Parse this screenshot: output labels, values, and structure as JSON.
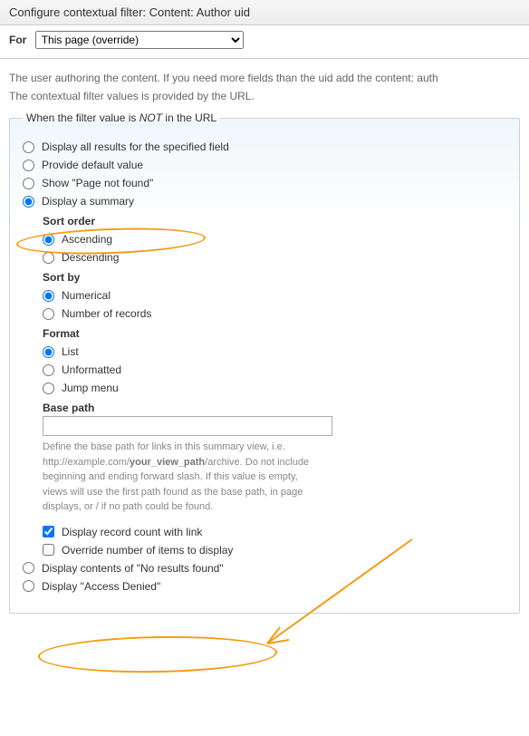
{
  "header": {
    "title": "Configure contextual filter: Content: Author uid",
    "for_label": "For",
    "for_value": "This page (override)"
  },
  "description": {
    "line1": "The user authoring the content. If you need more fields than the uid add the content: auth",
    "line2": "The contextual filter values is provided by the URL."
  },
  "fieldset": {
    "legend_prefix": "When the filter value is ",
    "legend_em": "NOT",
    "legend_suffix": " in the URL",
    "options": {
      "all_results": "Display all results for the specified field",
      "default_value": "Provide default value",
      "not_found": "Show \"Page not found\"",
      "summary": "Display a summary",
      "no_results": "Display contents of \"No results found\"",
      "access_denied": "Display \"Access Denied\""
    },
    "summary": {
      "sort_order_label": "Sort order",
      "sort_order": {
        "asc": "Ascending",
        "desc": "Descending"
      },
      "sort_by_label": "Sort by",
      "sort_by": {
        "num": "Numerical",
        "records": "Number of records"
      },
      "format_label": "Format",
      "format": {
        "list": "List",
        "unformatted": "Unformatted",
        "jump": "Jump menu"
      },
      "base_path_label": "Base path",
      "base_path_value": "",
      "base_path_help_pre": "Define the base path for links in this summary view, i.e.\nhttp://example.com/",
      "base_path_help_strong": "your_view_path",
      "base_path_help_post": "/archive. Do not include beginning and ending forward slash. If this value is empty, views will use the first path found as the base path, in page displays, or / if no path could be found.",
      "display_count": "Display record count with link",
      "override_items": "Override number of items to display"
    }
  }
}
